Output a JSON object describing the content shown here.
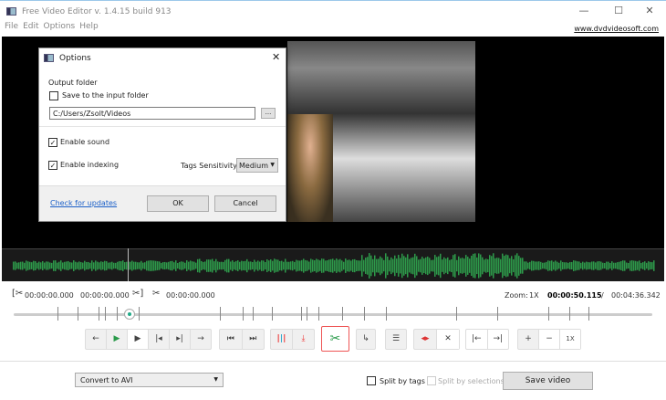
{
  "window": {
    "title": "Free Video Editor v. 1.4.15 build 913",
    "minimize": "—",
    "maximize": "☐",
    "close": "✕"
  },
  "menu": [
    "File",
    "Edit",
    "Options",
    "Help"
  ],
  "website": "www.dvdvideosoft.com",
  "dialog": {
    "title": "Options",
    "close": "✕",
    "output_folder_label": "Output folder",
    "save_to_input": {
      "label": "Save to the input folder",
      "checked": false
    },
    "path": "C:/Users/Zsolt/Videos",
    "browse": "...",
    "enable_sound": {
      "label": "Enable sound",
      "checked": true
    },
    "enable_indexing": {
      "label": "Enable indexing",
      "checked": true
    },
    "tags_sensitivity_label": "Tags Sensitivity:",
    "tags_sensitivity_value": "Medium",
    "check_updates": "Check for updates",
    "ok": "OK",
    "cancel": "Cancel"
  },
  "timeline": {
    "sel_start": "00:00:00.000",
    "sel_end": "00:00:00.000",
    "cut": "00:00:00.000",
    "zoom_label": "Zoom:",
    "zoom_value": "1X",
    "current": "00:00:50.115",
    "separator": "/",
    "total": "00:04:36.342",
    "position_fraction": 0.181
  },
  "controls": {
    "zoom_reset": "1X"
  },
  "bottom": {
    "format": "Convert to AVI",
    "split_tags": {
      "label": "Split by tags",
      "checked": false
    },
    "split_selections": {
      "label": "Split by selections",
      "checked": false,
      "disabled": true
    },
    "save": "Save video"
  }
}
